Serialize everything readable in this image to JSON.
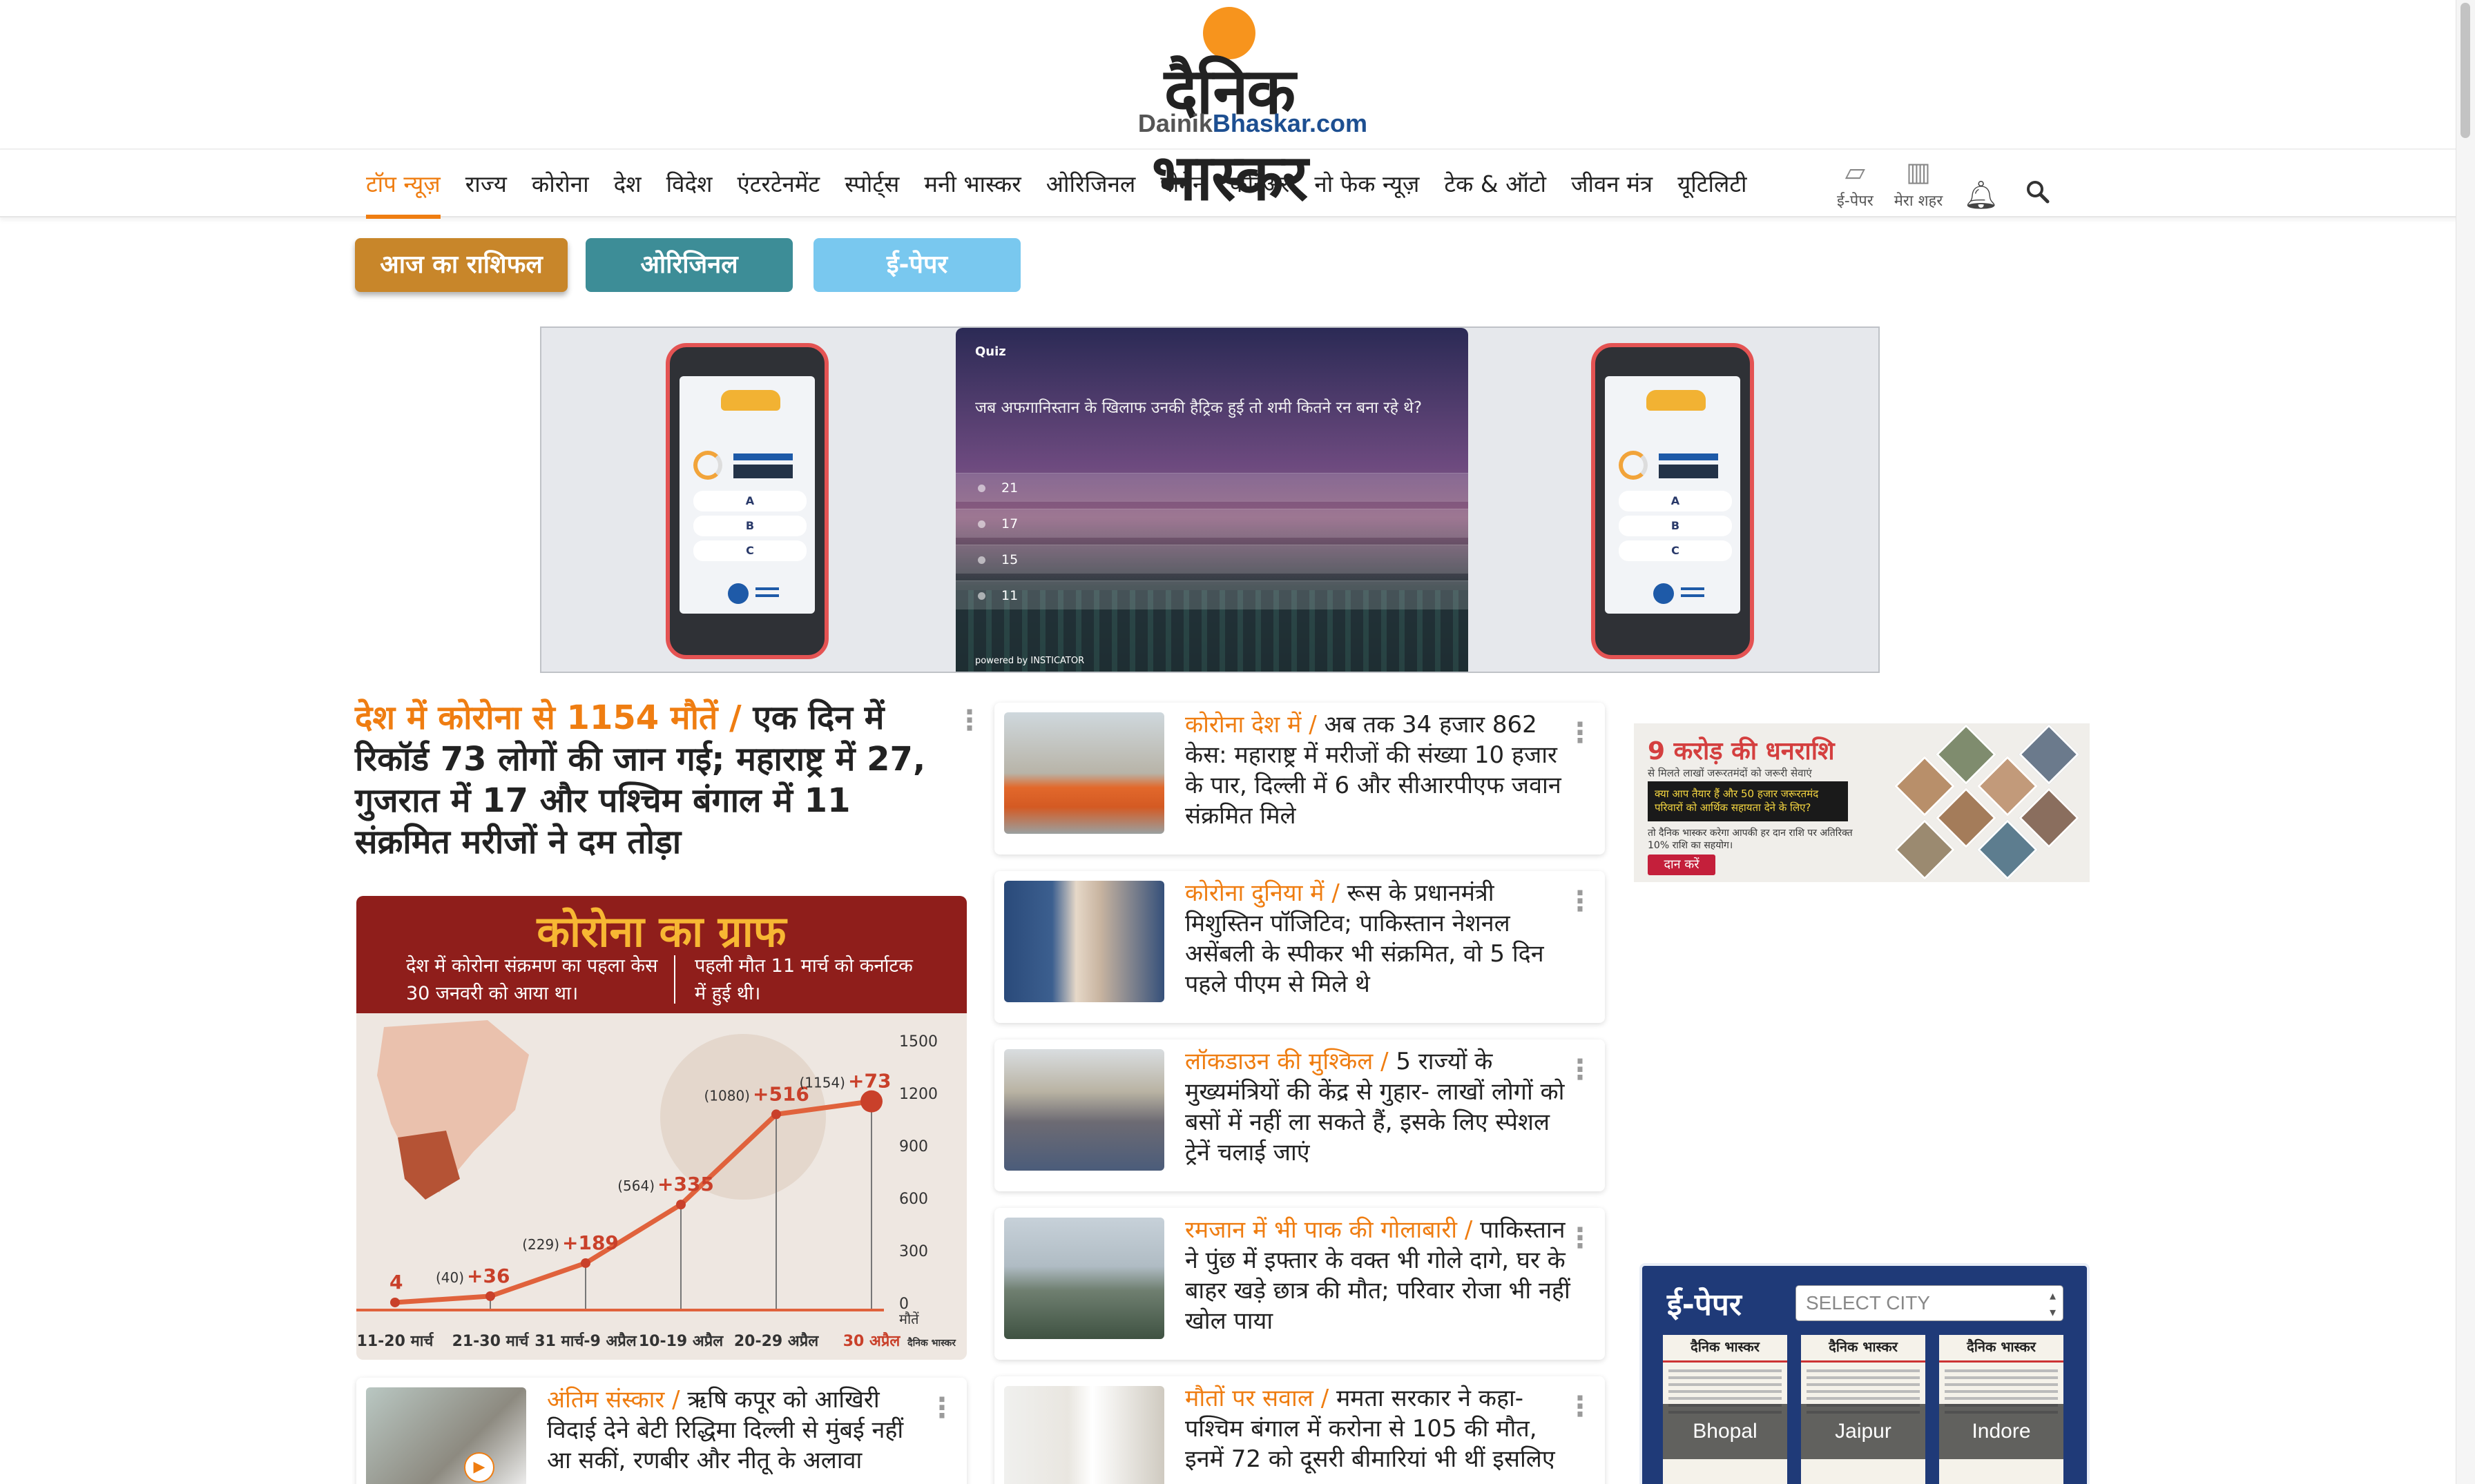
{
  "logo": {
    "hindi": "दैनिक भास्कर",
    "domain_a": "Dainik",
    "domain_b": "Bhaskar.com"
  },
  "nav": {
    "items": [
      {
        "label": "टॉप न्यूज़",
        "active": true
      },
      {
        "label": "राज्य"
      },
      {
        "label": "कोरोना"
      },
      {
        "label": "देश"
      },
      {
        "label": "विदेश"
      },
      {
        "label": "एंटरटेनमेंट"
      },
      {
        "label": "स्पोर्ट्स"
      },
      {
        "label": "मनी भास्कर"
      },
      {
        "label": "ओरिजिनल"
      },
      {
        "label": "वीमेन"
      },
      {
        "label": "करिअर"
      },
      {
        "label": "नो फेक न्यूज़"
      },
      {
        "label": "टेक & ऑटो"
      },
      {
        "label": "जीवन मंत्र"
      },
      {
        "label": "यूटिलिटी"
      }
    ],
    "epaper_label": "ई-पेपर",
    "city_label": "मेरा शहर",
    "icons": [
      "newspaper-icon",
      "building-icon",
      "bell-icon",
      "search-icon"
    ]
  },
  "quick_buttons": {
    "rashifal": "आज का राशिफल",
    "original": "ओरिजिनल",
    "epaper": "ई-पेपर"
  },
  "quiz_ad": {
    "tag": "Quiz",
    "question": "जब अफगानिस्तान के खिलाफ उनकी हैट्रिक हुई तो शमी कितने रन बना रहे थे?",
    "options": [
      "21",
      "17",
      "15",
      "11"
    ],
    "powered_by": "powered by INSTICATOR",
    "phone_options": [
      "A",
      "B",
      "C"
    ]
  },
  "lead": {
    "category": "देश में कोरोना से 1154 मौतें /",
    "title": " एक दिन में रिकॉर्ड 73 लोगों की जान गई; महाराष्ट्र में 27, गुजरात में 17 और पश्चिम बंगाल में 11 संक्रमित मरीजों ने दम तोड़ा"
  },
  "graph": {
    "title": "कोरोना का ग्राफ",
    "note_left": "देश में कोरोना संक्रमण का पहला केस 30 जनवरी को आया था।",
    "note_right": "पहली मौत 11 मार्च को कर्नाटक में हुई थी।",
    "y_unit": "मौतें",
    "brand": "दैनिक भास्कर"
  },
  "chart_data": {
    "type": "line",
    "title": "कोरोना का ग्राफ",
    "categories": [
      "11-20 मार्च",
      "21-30 मार्च",
      "31 मार्च-9 अप्रैल",
      "10-19 अप्रैल",
      "20-29 अप्रैल",
      "30 अप्रैल"
    ],
    "series": [
      {
        "values": [
          4,
          40,
          229,
          564,
          1080,
          1154
        ]
      }
    ],
    "increments": [
      "4",
      "+36",
      "+189",
      "+335",
      "+516",
      "+73"
    ],
    "totals_labels": [
      "",
      "(40)",
      "(229)",
      "(564)",
      "(1080)",
      "(1154)"
    ],
    "yticks": [
      0,
      300,
      600,
      900,
      1200,
      1500
    ],
    "ylabel": "मौतें",
    "ylim": [
      0,
      1500
    ],
    "accent": "#e0623c"
  },
  "cards": [
    {
      "category": "कोरोना देश में /",
      "text": " अब तक 34 हजार 862 केस: महाराष्ट्र में मरीजों की संख्या 10 हजार के पार, दिल्ली में 6 और सीआरपीएफ जवान संक्रमित मिले"
    },
    {
      "category": "कोरोना दुनिया में /",
      "text": " रूस के प्रधानमंत्री मिशुस्तिन पॉजिटिव; पाकिस्तान नेशनल असेंबली के स्पीकर भी संक्रमित, वो 5 दिन पहले पीएम से मिले थे"
    },
    {
      "category": "लॉकडाउन की मुश्किल /",
      "text": " 5 राज्यों के मुख्यमंत्रियों की केंद्र से गुहार- लाखों लोगों को बसों में नहीं ला सकते हैं, इसके लिए स्पेशल ट्रेनें चलाई जाएं"
    },
    {
      "category": "रमजान में भी पाक की गोलाबारी /",
      "text": " पाकिस्तान ने पुंछ में इफ्तार के वक्त भी गोले दागे, घर के बाहर खड़े छात्र की मौत; परिवार रोजा भी नहीं खोल पाया"
    },
    {
      "category": "मौतों पर सवाल /",
      "text": " ममता सरकार ने कहा- पश्चिम बंगाल में करोना से 105 की मौत, इनमें 72 को दूसरी बीमारियां भी थीं इसलिए"
    }
  ],
  "small_card": {
    "category": "अंतिम संस्कार /",
    "text": " ऋषि कपूर को आखिरी विदाई देने बेटी रिद्धिमा दिल्ली से मुंबई नहीं आ सकीं, रणबीर और नीतू के अलावा"
  },
  "donate_ad": {
    "heading": "9 करोड़ की धनराशि",
    "sub": "से मिलते लाखों जरूरतमंदों को जरूरी सेवाएं",
    "box": "क्या आप तैयार हैं और 50 हजार जरूरतमंद परिवारों को आर्थिक सहायता देने के लिए?",
    "note": "तो दैनिक भास्कर करेगा आपकी हर दान राशि पर अतिरिक्त 10% राशि का सहयोग।",
    "button": "दान करें"
  },
  "epaper_widget": {
    "title": "ई-पेपर",
    "select_placeholder": "SELECT CITY",
    "papers": [
      {
        "mast": "दैनिक भास्कर",
        "city": "Bhopal"
      },
      {
        "mast": "दैनिक भास्कर",
        "city": "Jaipur"
      },
      {
        "mast": "दैनिक भास्कर",
        "city": "Indore"
      }
    ]
  }
}
